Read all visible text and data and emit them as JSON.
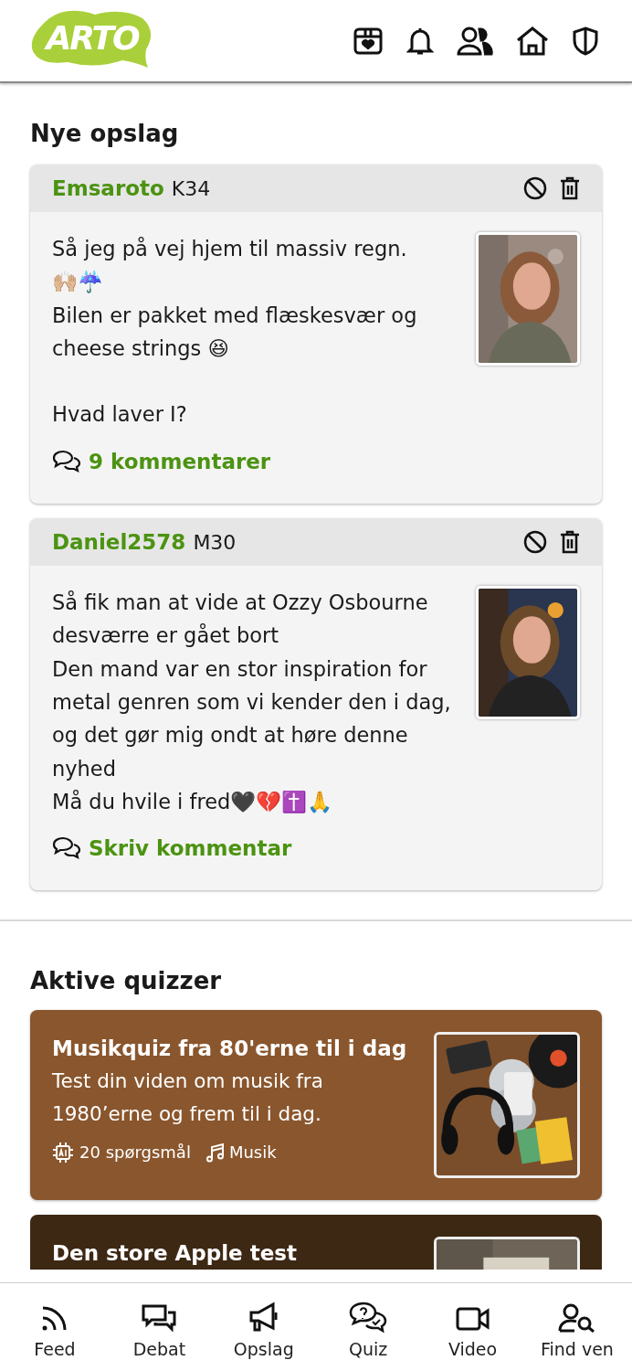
{
  "header": {
    "logo": "ARTO"
  },
  "posts_section": {
    "title": "Nye opslag"
  },
  "posts": [
    {
      "author": "Emsaroto",
      "tag": "K34",
      "text": "Så jeg på vej hjem til massiv regn.\n🙌🏼☔️\nBilen er pakket med flæskesvær og cheese strings 😆\n\nHvad laver I?",
      "comments": "9 kommentarer"
    },
    {
      "author": "Daniel2578",
      "tag": "M30",
      "text": "Så fik man at vide at Ozzy Osbourne desværre er gået bort\nDen mand var en stor inspiration for metal genren som vi kender den i dag, og det gør mig ondt at høre denne nyhed\nMå du hvile i fred🖤💔✝️🙏",
      "comments": "Skriv kommentar"
    }
  ],
  "quiz_section": {
    "title": "Aktive quizzer"
  },
  "quizzes": [
    {
      "title": "Musikquiz fra 80'erne til i dag",
      "description": "Test din viden om musik fra 1980’erne og frem til i dag.",
      "questions": "20 spørgsmål",
      "category": "Musik",
      "color": "#8a562d"
    },
    {
      "title": "Den store Apple test",
      "color": "#3d2814"
    }
  ],
  "bottom_nav": [
    {
      "kind": "feed",
      "label": "Feed"
    },
    {
      "kind": "debate",
      "label": "Debat"
    },
    {
      "kind": "ads",
      "label": "Opslag"
    },
    {
      "kind": "quiz",
      "label": "Quiz"
    },
    {
      "kind": "video",
      "label": "Video"
    },
    {
      "kind": "find",
      "label": "Find ven"
    }
  ]
}
